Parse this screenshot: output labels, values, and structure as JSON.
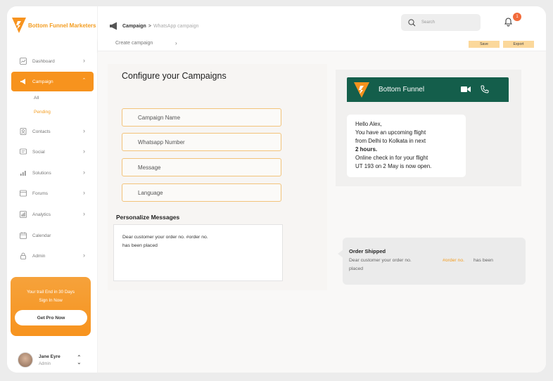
{
  "brand": {
    "name": "Bottom Funnel Marketers",
    "accent": "#f7931e"
  },
  "sidebar": {
    "items": [
      {
        "label": "Dashboard",
        "icon": "dashboard-icon"
      },
      {
        "label": "Campaign",
        "icon": "megaphone-icon"
      },
      {
        "label": "Contacts",
        "icon": "contacts-icon"
      },
      {
        "label": "Social",
        "icon": "social-icon"
      },
      {
        "label": "Solutions",
        "icon": "solutions-icon"
      },
      {
        "label": "Forums",
        "icon": "forums-icon"
      },
      {
        "label": "Analytics",
        "icon": "analytics-icon"
      },
      {
        "label": "Calendar",
        "icon": "calendar-icon"
      },
      {
        "label": "Admin",
        "icon": "lock-icon"
      }
    ],
    "campaign_sub": [
      "All",
      "Pending"
    ],
    "promo": {
      "line1": "Your trail End in 30 Days",
      "line2": "Sign In Now",
      "button": "Get Pro Now"
    },
    "user": {
      "name": "Jane Eyre",
      "role": "Admin"
    }
  },
  "header": {
    "breadcrumb": {
      "section": "Campaign",
      "separator": ">",
      "current": "WhatsApp campaign"
    },
    "search_placeholder": "Search",
    "notification_count": "1"
  },
  "subbar": {
    "create": "Create campaign",
    "save": "Save",
    "export": "Export"
  },
  "config": {
    "title": "Configure your Campaigns",
    "fields": [
      "Campaign Name",
      "Whatsapp Number",
      "Message",
      "Language"
    ],
    "personalize_label": "Personalize Messages",
    "personalize_line1": "Dear customer your order no. #order no.",
    "personalize_line2": "has been placed"
  },
  "preview": {
    "contact": "Bottom Funnel",
    "header_color": "#145e4b",
    "message": {
      "l1": "Hello Alex,",
      "l2": "You have an upcoming flight",
      "l3": "from Delhi to Kolkata in next",
      "l4": "2 hours.",
      "l5": "Online check in for your flight",
      "l6": "UT 193 on 2 May is now open."
    },
    "shipped": {
      "title": "Order Shipped",
      "l1": "Dear customer your order no.",
      "var": "#order no.",
      "l1b": "has been",
      "l2": "placed"
    }
  }
}
